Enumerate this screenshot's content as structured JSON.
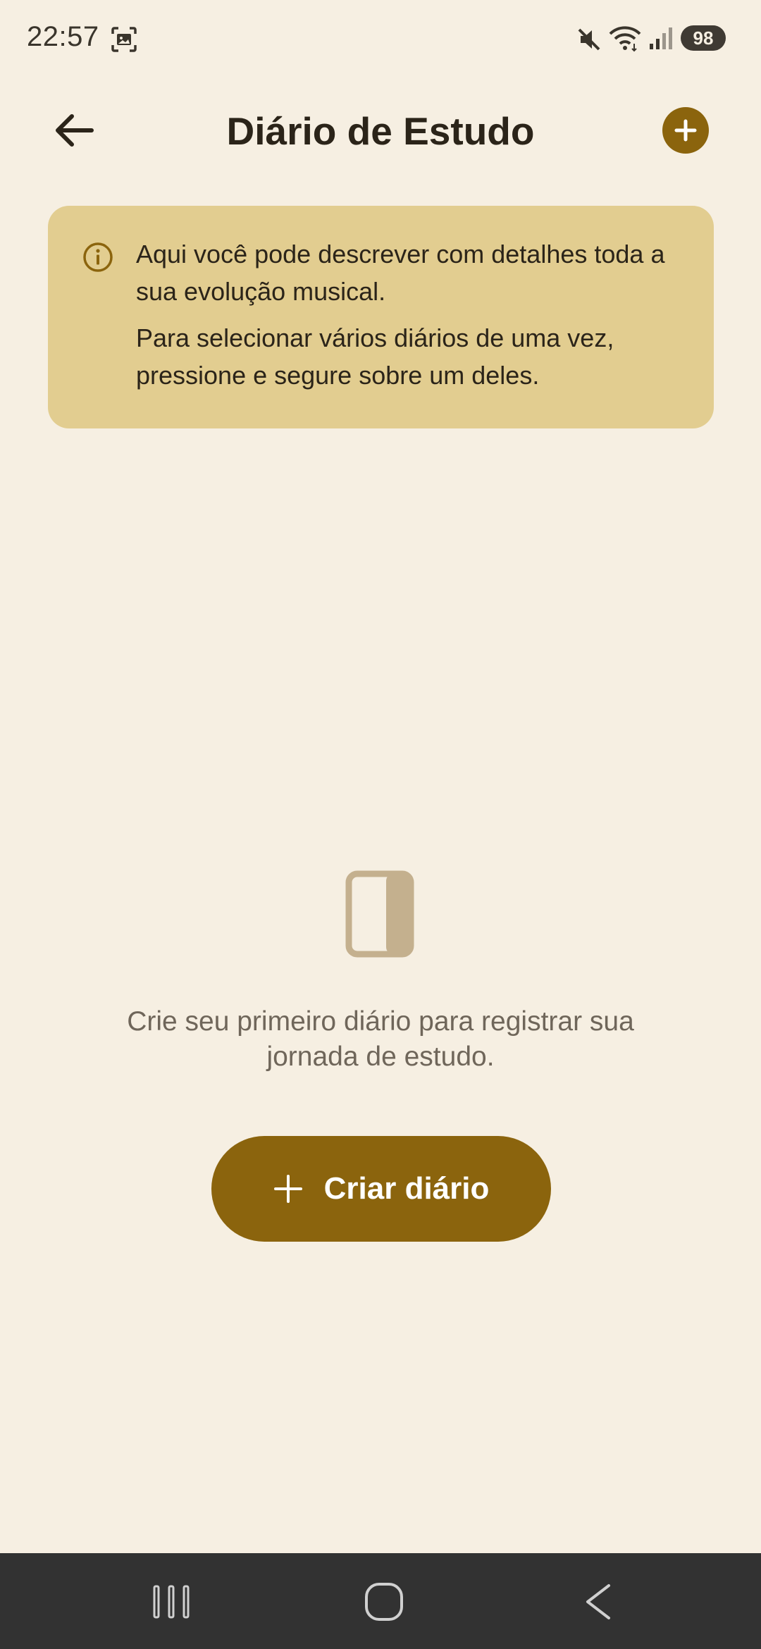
{
  "status_bar": {
    "time": "22:57",
    "battery": "98",
    "icons": [
      "screenshot-icon",
      "mute-icon",
      "wifi-icon",
      "signal-icon"
    ]
  },
  "app_bar": {
    "title": "Diário de Estudo",
    "back_icon": "arrow-left-icon",
    "add_icon": "plus-circle-icon"
  },
  "info_card": {
    "icon": "info-icon",
    "line1": "Aqui você pode descrever com detalhes toda a sua evolução musical.",
    "line2": "Para selecionar vários diários de uma vez, pressione e segure sobre um deles."
  },
  "empty_state": {
    "icon": "journal-icon",
    "message": "Crie seu primeiro diário para registrar sua jornada de estudo."
  },
  "create_button": {
    "label": "Criar diário",
    "icon": "plus-icon"
  },
  "nav_bar": {
    "icons": [
      "recents-icon",
      "home-icon",
      "back-icon"
    ]
  },
  "colors": {
    "background": "#f6efe2",
    "accent": "#8b640d",
    "info_card": "#e2cd90",
    "nav_bar": "#323232"
  }
}
